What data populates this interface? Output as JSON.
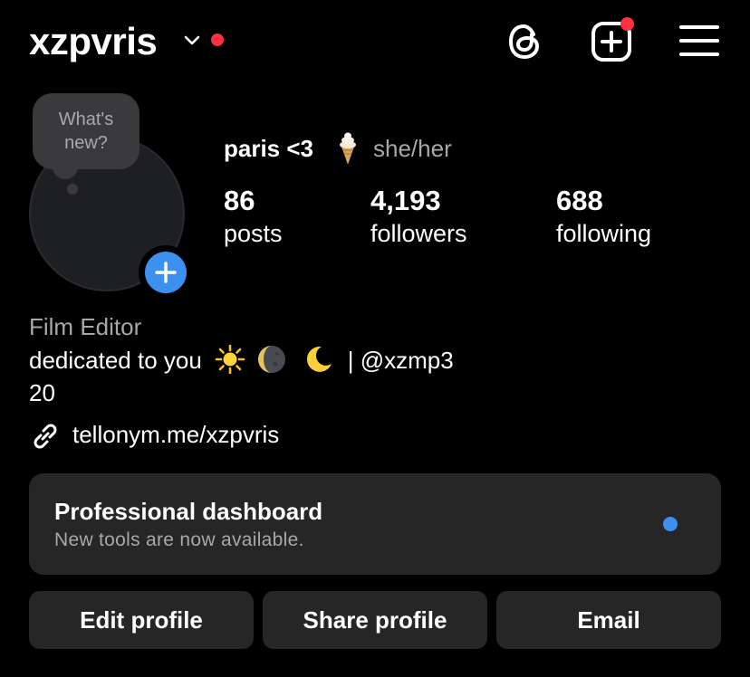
{
  "header": {
    "username": "xzpvris",
    "account_switch_icon": "chevron-down-icon",
    "threads_icon": "threads-icon",
    "create_icon": "plus-square-icon",
    "menu_icon": "hamburger-menu-icon"
  },
  "profile": {
    "note_placeholder": "What's\nnew?",
    "display_name": "paris <3",
    "name_emoji": "soft-serve-icon",
    "pronouns": "she/her",
    "stats": [
      {
        "value": "86",
        "label": "posts"
      },
      {
        "value": "4,193",
        "label": "followers"
      },
      {
        "value": "688",
        "label": "following"
      }
    ],
    "category": "Film Editor",
    "bio_line1_prefix": "dedicated to you",
    "bio_line1_suffix": "| @xzmp3",
    "bio_line2": "20",
    "link": "tellonym.me/xzpvris"
  },
  "dashboard": {
    "title": "Professional dashboard",
    "subtitle": "New tools are now available."
  },
  "buttons": {
    "edit": "Edit profile",
    "share": "Share profile",
    "email": "Email"
  },
  "colors": {
    "background": "#000000",
    "card": "#262626",
    "accent_blue": "#3b90f0",
    "notification_red": "#ff3040",
    "muted_text": "#a8a8a8"
  }
}
